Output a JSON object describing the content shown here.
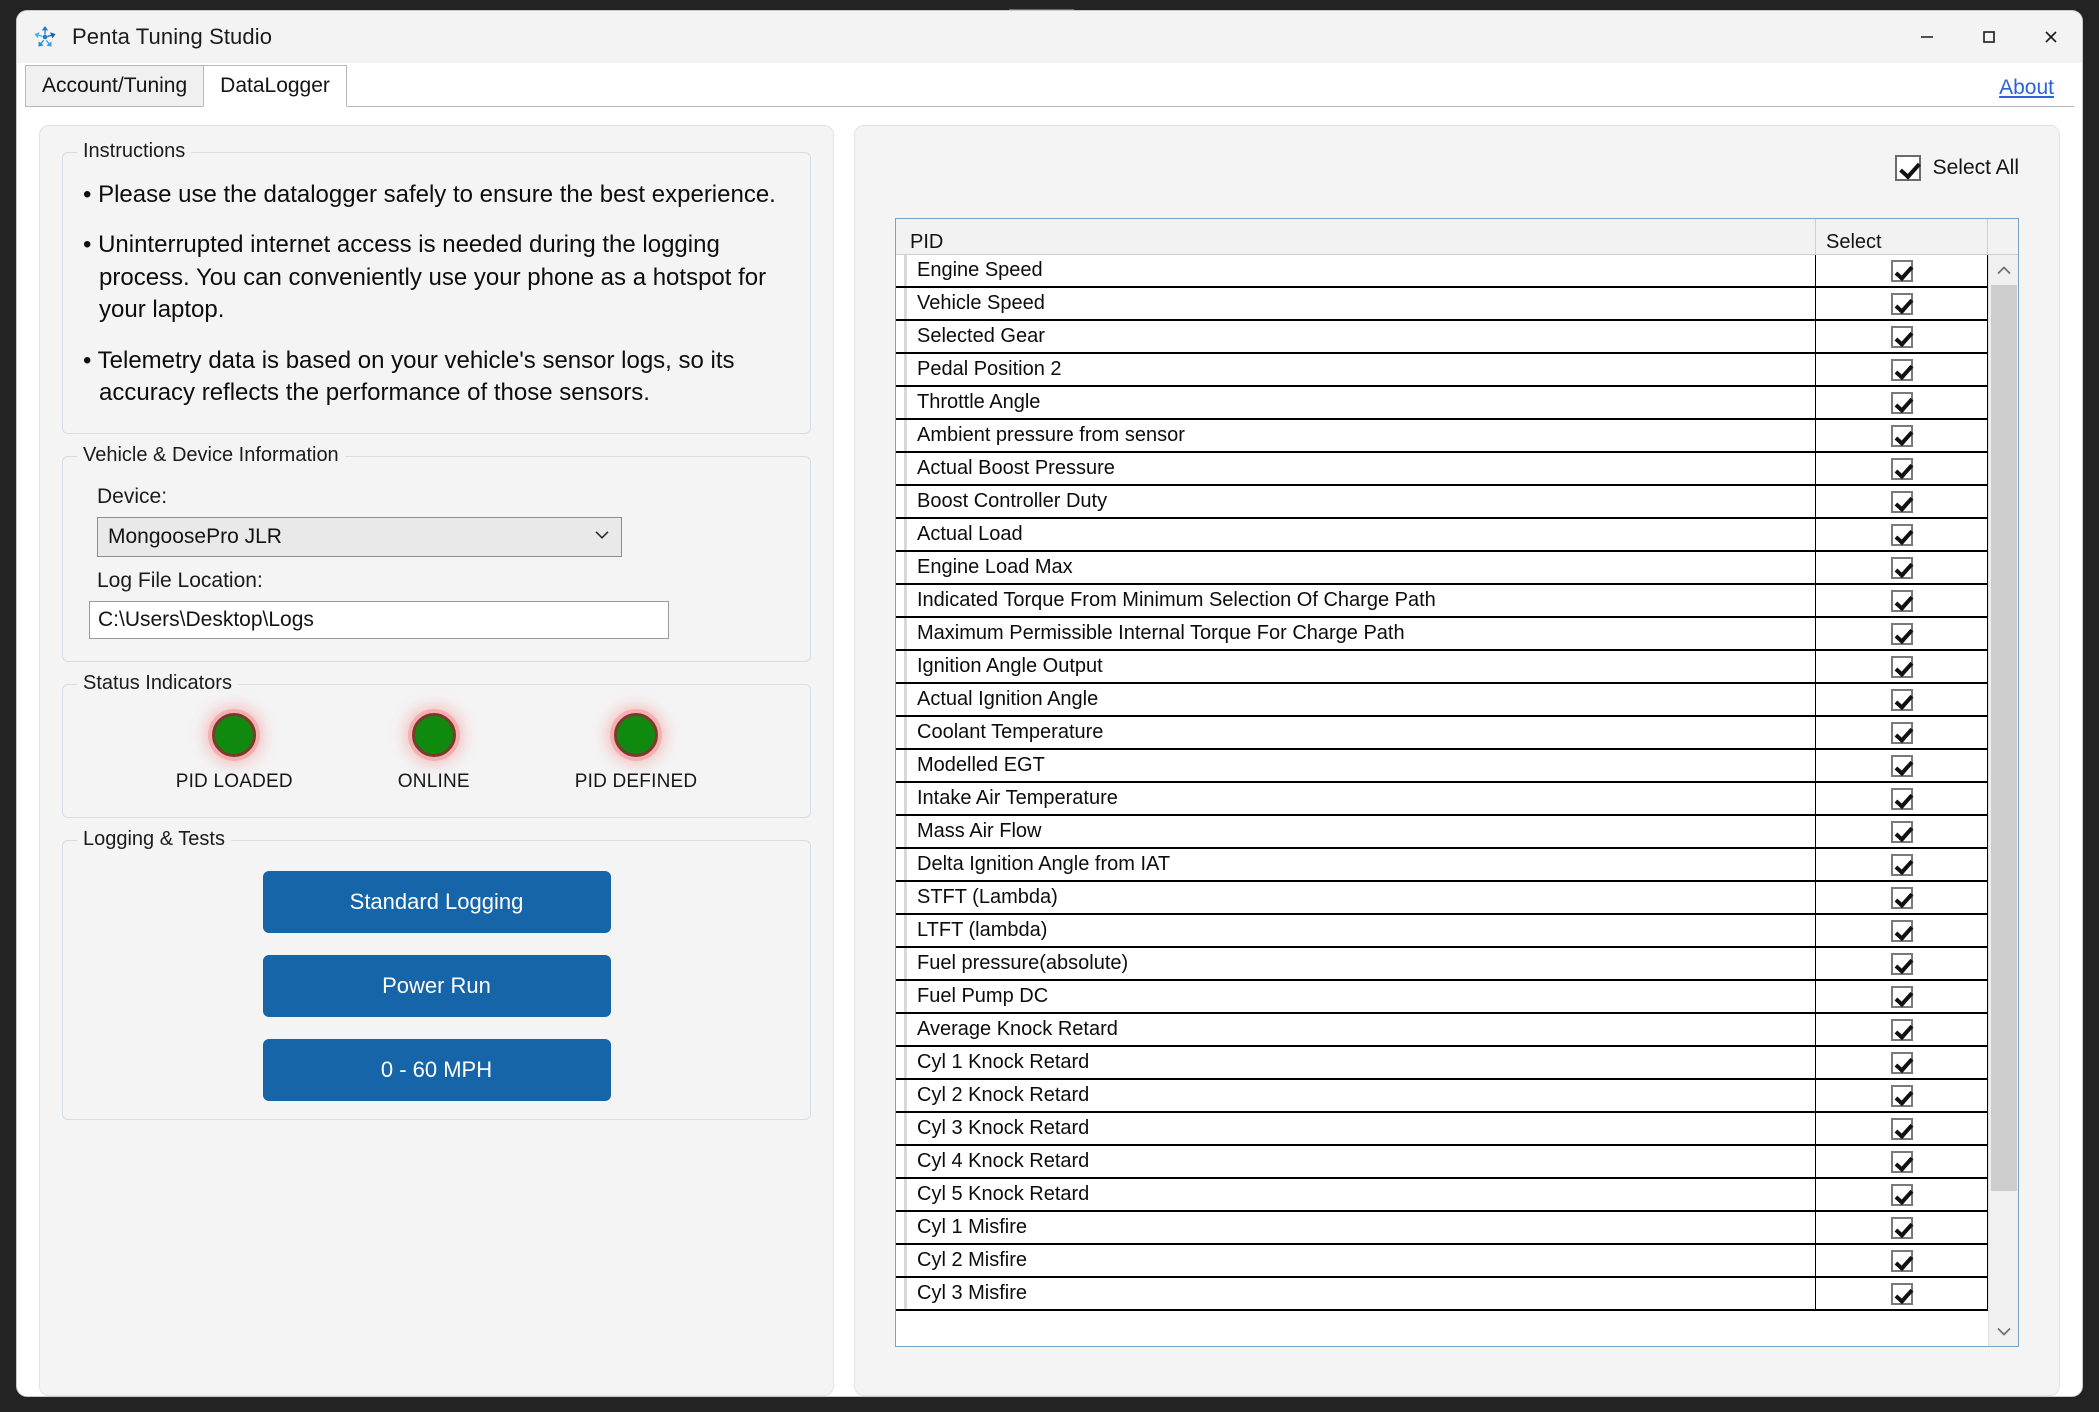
{
  "window": {
    "title": "Penta Tuning Studio",
    "icon": "penta-pinwheel-icon",
    "minimize_label": "—",
    "maximize_label": "☐",
    "close_label": "✕"
  },
  "tabs": [
    {
      "label": "Account/Tuning",
      "active": false
    },
    {
      "label": "DataLogger",
      "active": true
    }
  ],
  "about_link": "About",
  "left": {
    "instructions": {
      "legend": "Instructions",
      "bullets": [
        "• Please use the datalogger safely to ensure the best experience.",
        "• Uninterrupted internet access is needed during the logging process. You can conveniently use your phone as a hotspot for your laptop.",
        "• Telemetry data is based on your vehicle's sensor logs, so its accuracy reflects the performance of those sensors."
      ]
    },
    "vehicle_device": {
      "legend": "Vehicle & Device Information",
      "device_label": "Device:",
      "device_value": "MongoosePro JLR",
      "device_chevron": "⌄",
      "log_label": "Log File Location:",
      "log_value": "C:\\Users\\Desktop\\Logs"
    },
    "status": {
      "legend": "Status Indicators",
      "indicators": [
        {
          "label": "PID LOADED",
          "state": "on",
          "color": "#0f8a0f"
        },
        {
          "label": "ONLINE",
          "state": "on",
          "color": "#0f8a0f"
        },
        {
          "label": "PID DEFINED",
          "state": "on",
          "color": "#0f8a0f"
        }
      ]
    },
    "logging": {
      "legend": "Logging & Tests",
      "buttons": [
        "Standard Logging",
        "Power Run",
        "0 - 60 MPH"
      ],
      "accent_color": "#1565a8"
    }
  },
  "right": {
    "select_all_label": "Select All",
    "select_all_checked": true,
    "columns": [
      "PID",
      "Select"
    ],
    "scroll": {
      "up_arrow": "∧",
      "down_arrow": "∨",
      "thumb_percent": 83
    },
    "rows": [
      {
        "pid": "Engine Speed",
        "selected": true
      },
      {
        "pid": "Vehicle Speed",
        "selected": true
      },
      {
        "pid": "Selected Gear",
        "selected": true
      },
      {
        "pid": "Pedal Position 2",
        "selected": true
      },
      {
        "pid": "Throttle Angle",
        "selected": true
      },
      {
        "pid": "Ambient pressure from sensor",
        "selected": true
      },
      {
        "pid": "Actual Boost Pressure",
        "selected": true
      },
      {
        "pid": "Boost Controller Duty",
        "selected": true
      },
      {
        "pid": "Actual Load",
        "selected": true
      },
      {
        "pid": "Engine Load Max",
        "selected": true
      },
      {
        "pid": "Indicated Torque From Minimum Selection Of Charge Path",
        "selected": true
      },
      {
        "pid": "Maximum Permissible Internal Torque For Charge Path",
        "selected": true
      },
      {
        "pid": "Ignition Angle Output",
        "selected": true
      },
      {
        "pid": "Actual Ignition Angle",
        "selected": true
      },
      {
        "pid": "Coolant Temperature",
        "selected": true
      },
      {
        "pid": "Modelled EGT",
        "selected": true
      },
      {
        "pid": "Intake Air Temperature",
        "selected": true
      },
      {
        "pid": "Mass Air Flow",
        "selected": true
      },
      {
        "pid": "Delta Ignition Angle from IAT",
        "selected": true
      },
      {
        "pid": "STFT (Lambda)",
        "selected": true
      },
      {
        "pid": "LTFT (lambda)",
        "selected": true
      },
      {
        "pid": "Fuel pressure(absolute)",
        "selected": true
      },
      {
        "pid": "Fuel Pump DC",
        "selected": true
      },
      {
        "pid": "Average Knock Retard",
        "selected": true
      },
      {
        "pid": "Cyl 1 Knock Retard",
        "selected": true
      },
      {
        "pid": "Cyl 2 Knock Retard",
        "selected": true
      },
      {
        "pid": "Cyl 3 Knock Retard",
        "selected": true
      },
      {
        "pid": "Cyl 4 Knock Retard",
        "selected": true
      },
      {
        "pid": "Cyl 5 Knock Retard",
        "selected": true
      },
      {
        "pid": "Cyl 1 Misfire",
        "selected": true
      },
      {
        "pid": "Cyl 2 Misfire",
        "selected": true
      },
      {
        "pid": "Cyl 3 Misfire",
        "selected": true
      }
    ]
  }
}
